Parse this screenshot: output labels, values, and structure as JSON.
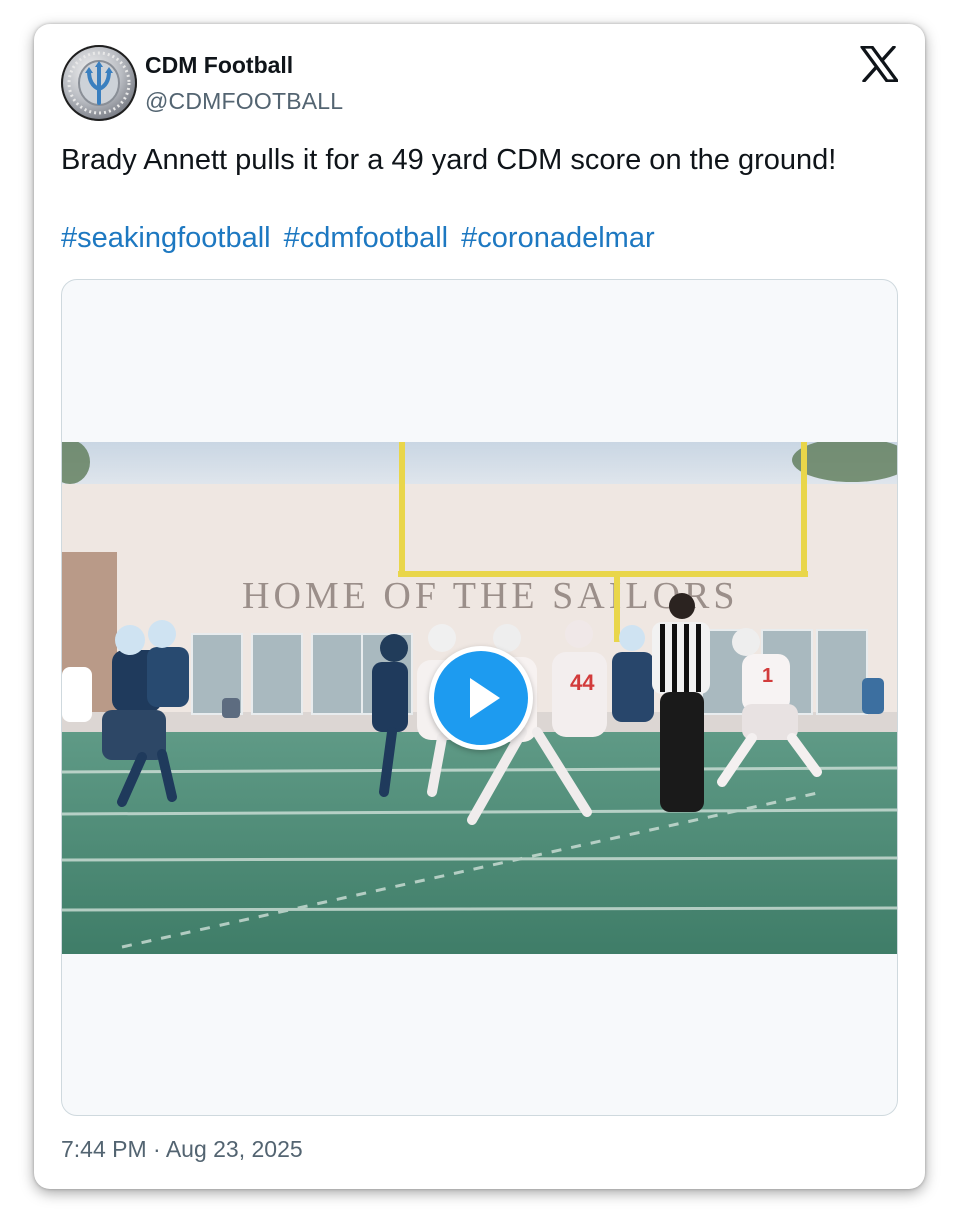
{
  "author": {
    "display_name": "CDM Football",
    "handle": "@CDMFOOTBALL"
  },
  "tweet": {
    "text": "Brady Annett pulls it for a 49 yard CDM score on the ground!",
    "hashtags": [
      "#seakingfootball",
      "#cdmfootball",
      "#coronadelmar"
    ],
    "timestamp": "7:44 PM · Aug 23, 2025"
  },
  "media": {
    "type": "video",
    "banner_text": "HOME OF THE SAILORS",
    "icon": "play-icon"
  },
  "icons": {
    "platform": "x-logo-icon",
    "avatar": "championship-ring-avatar"
  },
  "colors": {
    "text": "#0f1419",
    "secondary": "#536471",
    "hashtag": "#1d78c1",
    "play_button": "#1d9bf0",
    "field": "#4b8a74",
    "jersey_home": "#1f3a5c",
    "goalpost": "#e9d64a"
  }
}
